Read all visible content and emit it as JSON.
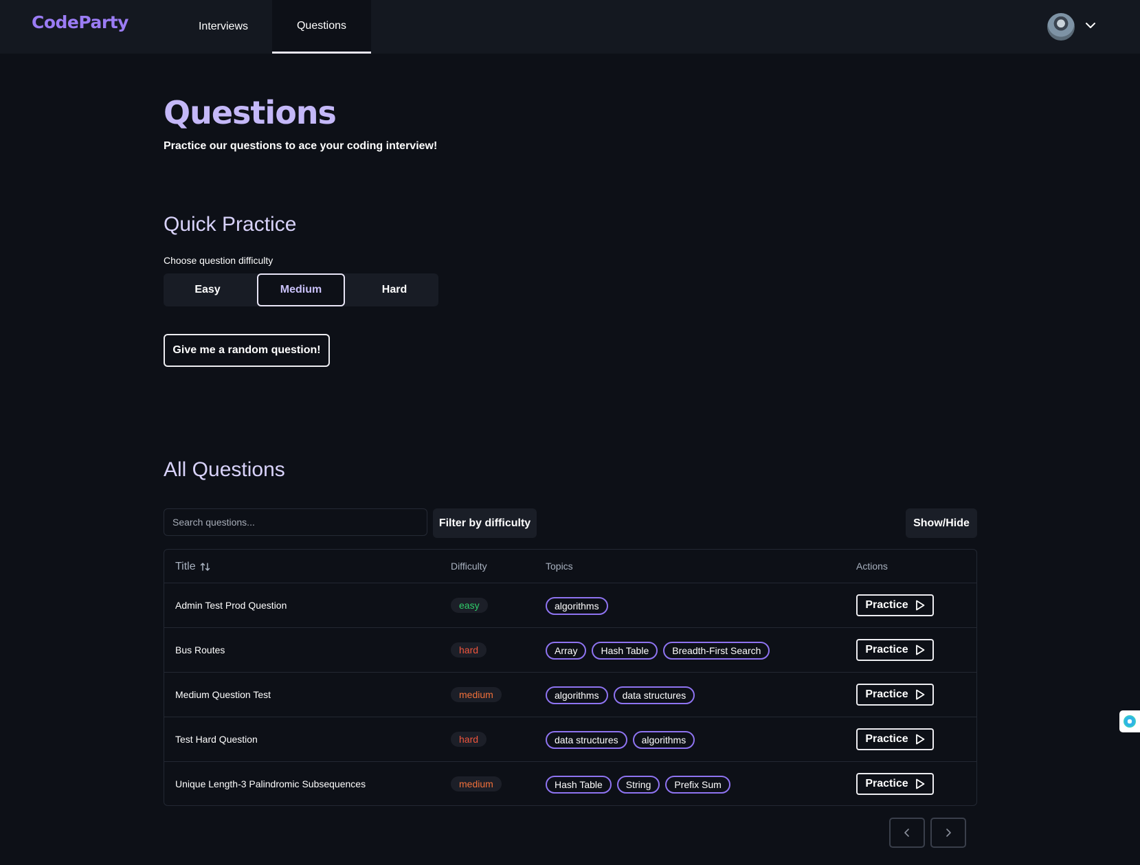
{
  "header": {
    "logo": "CodeParty",
    "nav": [
      {
        "label": "Interviews"
      },
      {
        "label": "Questions",
        "active": true
      }
    ]
  },
  "page": {
    "title": "Questions",
    "subtitle": "Practice our questions to ace your coding interview!"
  },
  "quick_practice": {
    "title": "Quick Practice",
    "difficulty_label": "Choose question difficulty",
    "options": [
      "Easy",
      "Medium",
      "Hard"
    ],
    "selected": "Medium",
    "random_button": "Give me a random question!"
  },
  "all_questions": {
    "title": "All Questions",
    "search_placeholder": "Search questions...",
    "filter_label": "Filter by difficulty",
    "show_hide_label": "Show/Hide",
    "columns": {
      "title": "Title",
      "difficulty": "Difficulty",
      "topics": "Topics",
      "actions": "Actions"
    },
    "practice_label": "Practice",
    "rows": [
      {
        "title": "Admin Test Prod Question",
        "difficulty": "easy",
        "topics": [
          "algorithms"
        ]
      },
      {
        "title": "Bus Routes",
        "difficulty": "hard",
        "topics": [
          "Array",
          "Hash Table",
          "Breadth-First Search"
        ]
      },
      {
        "title": "Medium Question Test",
        "difficulty": "medium",
        "topics": [
          "algorithms",
          "data structures"
        ]
      },
      {
        "title": "Test Hard Question",
        "difficulty": "hard",
        "topics": [
          "data structures",
          "algorithms"
        ]
      },
      {
        "title": "Unique Length-3 Palindromic Subsequences",
        "difficulty": "medium",
        "topics": [
          "Hash Table",
          "String",
          "Prefix Sum"
        ]
      }
    ]
  },
  "colors": {
    "background": "#0d1017",
    "accent": "#9b7cf4",
    "easy": "#2fcf6a",
    "hard": "#f0553d",
    "medium": "#f2703a"
  }
}
